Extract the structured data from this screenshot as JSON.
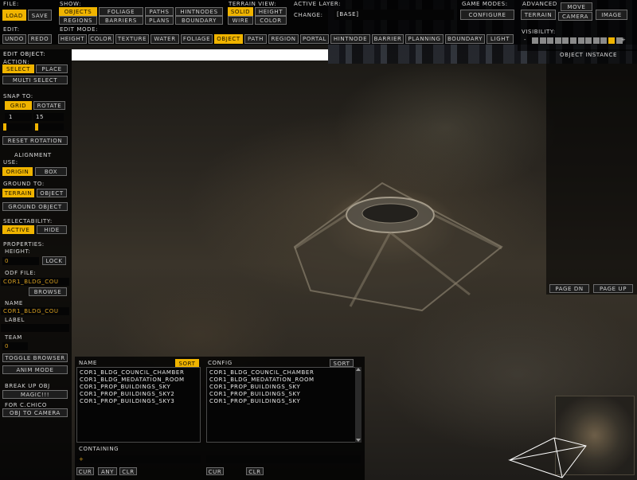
{
  "file": {
    "title": "File:",
    "load": "Load",
    "save": "Save"
  },
  "show": {
    "title": "Show:",
    "objects": "Objects",
    "foliage": "Foliage",
    "paths": "Paths",
    "hintnodes": "HintNodes",
    "regions": "Regions",
    "barriers": "Barriers",
    "plans": "Plans",
    "boundary": "Boundary"
  },
  "terrain_view": {
    "title": "Terrain View:",
    "solid": "Solid",
    "height": "Height",
    "wire": "Wire",
    "color": "Color"
  },
  "active_layer": {
    "title": "Active Layer:",
    "change": "Change:",
    "value": "[Base]"
  },
  "game_modes": {
    "title": "Game Modes:",
    "configure": "Configure"
  },
  "advanced": {
    "title": "Advanced",
    "move": "Move",
    "terrain": "Terrain",
    "camera": "Camera",
    "image": "Image"
  },
  "edit": {
    "title": "Edit:",
    "undo": "Undo",
    "redo": "Redo"
  },
  "edit_mode": {
    "title": "Edit Mode:",
    "modes": [
      "Height",
      "Color",
      "Texture",
      "Water",
      "Foliage",
      "Object",
      "Path",
      "Region",
      "Portal",
      "HintNode",
      "Barrier",
      "Planning",
      "Boundary",
      "Light"
    ],
    "active": "Object"
  },
  "visibility": {
    "title": "Visibility:",
    "minus": "-",
    "plus": "+",
    "level": 10,
    "total": 12
  },
  "edit_object": {
    "title": "Edit Object:",
    "action_title": "Action:",
    "select": "Select",
    "place": "Place",
    "multi_select": "Multi Select",
    "snap_title": "Snap To:",
    "grid": "Grid",
    "rotate": "Rotate",
    "grid_value": "1",
    "rotate_value": "15",
    "reset_rotation": "Reset Rotation",
    "alignment_title": "Alignment",
    "use_title": "Use:",
    "origin": "Origin",
    "box": "Box",
    "ground_to_title": "Ground To:",
    "terrain": "Terrain",
    "object": "Object",
    "ground_object": "Ground Object",
    "selectability_title": "Selectability:",
    "active": "Active",
    "hide": "Hide",
    "properties_title": "Properties:",
    "height_title": "Height:",
    "height_value": "0",
    "lock": "Lock",
    "odf_title": "Odf File:",
    "odf_value": "Cor1_bldg_Cou",
    "browse": "Browse",
    "name_title": "Name",
    "name_value": "Cor1_bldg_Cou",
    "label_title": "Label",
    "label_value": "",
    "team_title": "Team",
    "team_value": "0",
    "toggle_browser": "Toggle Browser",
    "anim_mode": "Anim Mode",
    "break_up_title": "Break Up Obj",
    "magic": "Magic!!!",
    "for_title": "For C.Chico",
    "obj_to_camera": "Obj To Camera"
  },
  "object_instance": {
    "title": "Object Instance",
    "page_dn": "Page Dn",
    "page_up": "Page Up"
  },
  "browser": {
    "name_title": "Name",
    "sort": "Sort",
    "config_title": "Config",
    "names": [
      "Cor1_bldg_Council_Chamber",
      "cor1_bldg_Medatation_Room",
      "cor1_prop_buildings_sky",
      "cor1_prop_buildings_sky2",
      "cor1_prop_buildings_sky3"
    ],
    "configs": [
      "Cor1_bldg_Council_Chamber",
      "Cor1_bldg_Medatation_Room",
      "cor1_prop_buildings_sky",
      "cor1_prop_buildings_sky",
      "cor1_prop_buildings_sky"
    ],
    "containing_title": "Containing",
    "containing_value": "+",
    "cur": "Cur",
    "any": "Any",
    "clr": "Clr"
  }
}
